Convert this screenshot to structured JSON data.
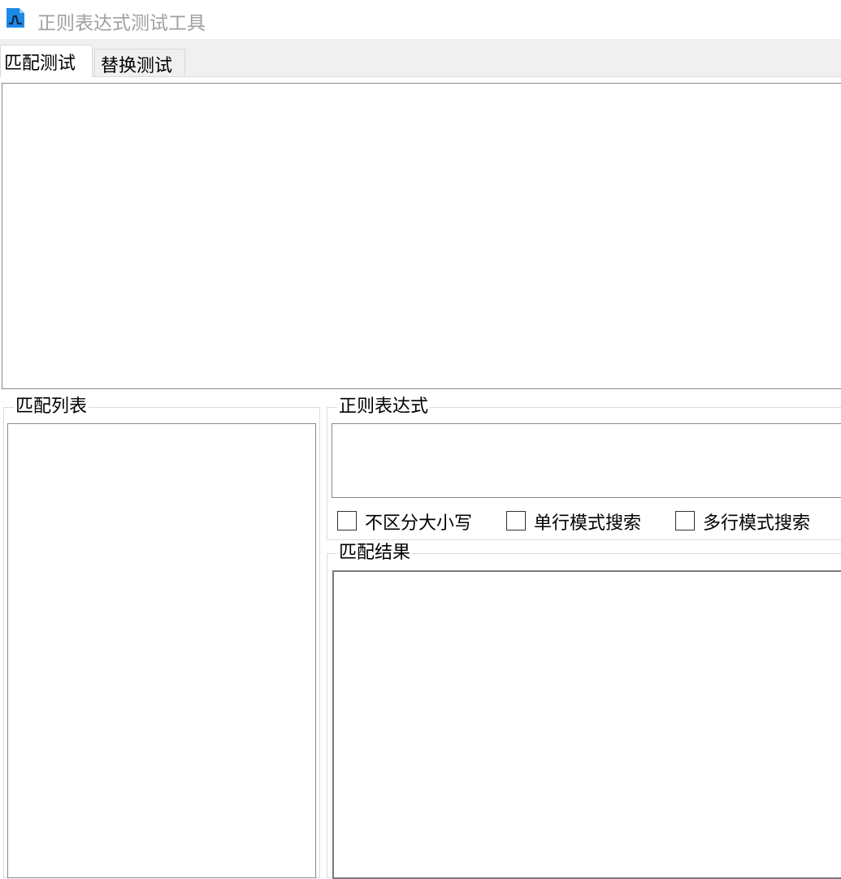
{
  "window": {
    "title": "正则表达式测试工具"
  },
  "tabs": [
    {
      "label": "匹配测试",
      "active": true
    },
    {
      "label": "替换测试",
      "active": false
    }
  ],
  "main": {
    "source_text": {
      "value": ""
    },
    "match_list": {
      "title": "匹配列表"
    },
    "regex": {
      "title": "正则表达式",
      "value": "",
      "options": [
        {
          "label": "不区分大小写",
          "checked": false
        },
        {
          "label": "单行模式搜索",
          "checked": false
        },
        {
          "label": "多行模式搜索",
          "checked": false
        }
      ]
    },
    "result": {
      "title": "匹配结果",
      "value": ""
    }
  },
  "colors": {
    "title_text": "#a0a0a0",
    "window_bg": "#f0f0f0",
    "border": "#8a8a8a",
    "group_border": "#dcdcdc",
    "icon_blue": "#1e88e5"
  },
  "icons": {
    "app_icon": "regex-app-icon"
  }
}
